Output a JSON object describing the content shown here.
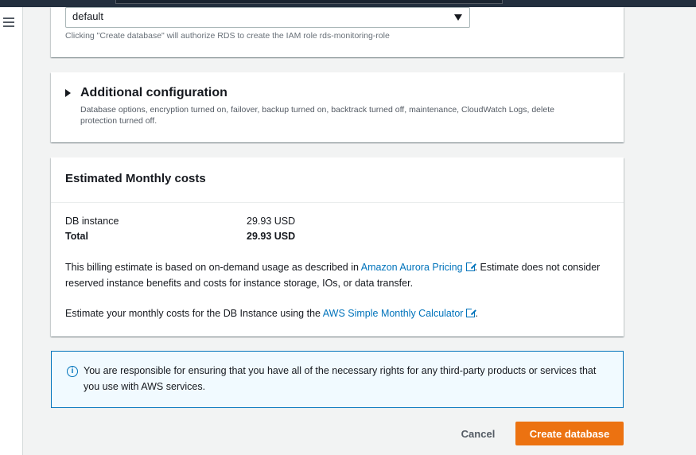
{
  "monitoring": {
    "role_select_value": "default",
    "hint": "Clicking \"Create database\" will authorize RDS to create the IAM role rds-monitoring-role"
  },
  "additional_config": {
    "title": "Additional configuration",
    "description": "Database options, encryption turned on, failover, backup turned on, backtrack turned off, maintenance, CloudWatch Logs, delete protection turned off."
  },
  "costs": {
    "title": "Estimated Monthly costs",
    "rows": [
      {
        "label": "DB instance",
        "value": "29.93 USD"
      },
      {
        "label": "Total",
        "value": "29.93 USD"
      }
    ],
    "billing_prefix": "This billing estimate is based on on-demand usage as described in ",
    "billing_link": "Amazon Aurora Pricing",
    "billing_suffix": ". Estimate does not consider reserved instance benefits and costs for instance storage, IOs, or data transfer.",
    "calc_prefix": "Estimate your monthly costs for the DB Instance using the ",
    "calc_link": "AWS Simple Monthly Calculator",
    "calc_suffix": "."
  },
  "info": {
    "text": "You are responsible for ensuring that you have all of the necessary rights for any third-party products or services that you use with AWS services."
  },
  "actions": {
    "cancel_label": "Cancel",
    "create_label": "Create database"
  },
  "colors": {
    "accent": "#ec7211",
    "link": "#0073bb",
    "info_bg": "#f1faff",
    "nav_dark": "#232f3e"
  }
}
